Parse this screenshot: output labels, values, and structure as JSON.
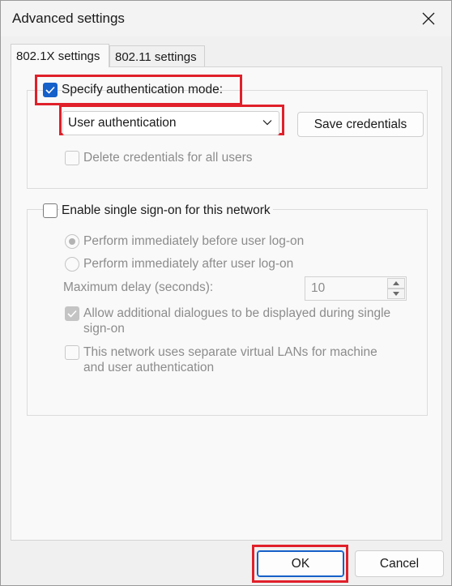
{
  "window": {
    "title": "Advanced settings"
  },
  "tabs": [
    {
      "label": "802.1X settings",
      "active": true
    },
    {
      "label": "802.11 settings",
      "active": false
    }
  ],
  "auth_group": {
    "specify_auth_label": "Specify authentication mode:",
    "specify_auth_checked": true,
    "auth_mode_selected": "User authentication",
    "save_credentials_label": "Save credentials",
    "delete_credentials_label": "Delete credentials for all users",
    "delete_credentials_checked": false
  },
  "sso_group": {
    "enable_sso_label": "Enable single sign-on for this network",
    "enable_sso_checked": false,
    "radio_before_label": "Perform immediately before user log-on",
    "radio_before_selected": true,
    "radio_after_label": "Perform immediately after user log-on",
    "radio_after_selected": false,
    "max_delay_label": "Maximum delay (seconds):",
    "max_delay_value": "10",
    "allow_dialogs_line1": "Allow additional dialogues to be displayed during single",
    "allow_dialogs_line2": "sign-on",
    "allow_dialogs_checked": true,
    "vlan_line1": "This network uses separate virtual LANs for machine",
    "vlan_line2": "and user authentication",
    "vlan_checked": false
  },
  "footer": {
    "ok_label": "OK",
    "cancel_label": "Cancel"
  },
  "colors": {
    "accent": "#1560c9",
    "highlight_box": "#e0202a"
  },
  "icons": {
    "close": "close-icon",
    "dropdown": "chevron-down-icon",
    "check": "checkmark-icon",
    "spin_up": "spin-up-icon",
    "spin_down": "spin-down-icon"
  }
}
